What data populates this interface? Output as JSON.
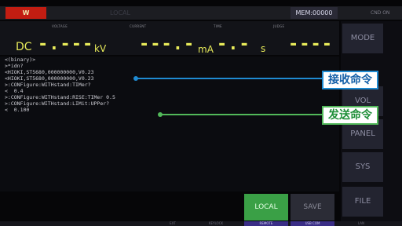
{
  "status_bar": {
    "warning_indicator": "W",
    "faded_indicator": "LOCAL",
    "memory": "MEM:00000",
    "mode_indicator": "CND ON"
  },
  "measurement": {
    "voltage_label": "VOLTAGE",
    "current_label": "CURRENT",
    "time_label": "TIME",
    "judge_label": "JUDGE",
    "dc_label": "DC",
    "voltage_value": "-.---",
    "voltage_unit": "kV",
    "current_value": "---.-",
    "current_unit": "mA",
    "time_value": "-.-",
    "time_unit": "s",
    "judge_value": "----"
  },
  "terminal": {
    "lines": [
      "<(binary)>",
      ">*idn?",
      "<HIOKI,ST5680,000000000,V0.23",
      "<HIOKI,ST5680,000000000,V0.23",
      ">:CONFigure:WITHstand:TIMer?",
      "<  0.4",
      ">:CONFigure:WITHstand:RISE:TIMer 0.5",
      ">:CONFigure:WITHstand:LIMit:UPPer?",
      "<  0.100"
    ]
  },
  "soft_keys": {
    "mode": "MODE",
    "vol": "VOL",
    "panel": "PANEL",
    "sys": "SYS",
    "file": "FILE"
  },
  "buttons": {
    "local": "LOCAL",
    "save": "SAVE"
  },
  "footer": {
    "ext": "EXT",
    "keylock": "KEYLOCK",
    "remote": "REMOTE",
    "usb": "USB COM",
    "lan": "LAN"
  },
  "annotations": {
    "receive_command": "接收命令",
    "send_command": "发送命令"
  },
  "colors": {
    "receive_accent": "#1f8bd2",
    "send_accent": "#52b95a",
    "local_button": "#3aa046",
    "measurement_text": "#e8eb5a"
  }
}
